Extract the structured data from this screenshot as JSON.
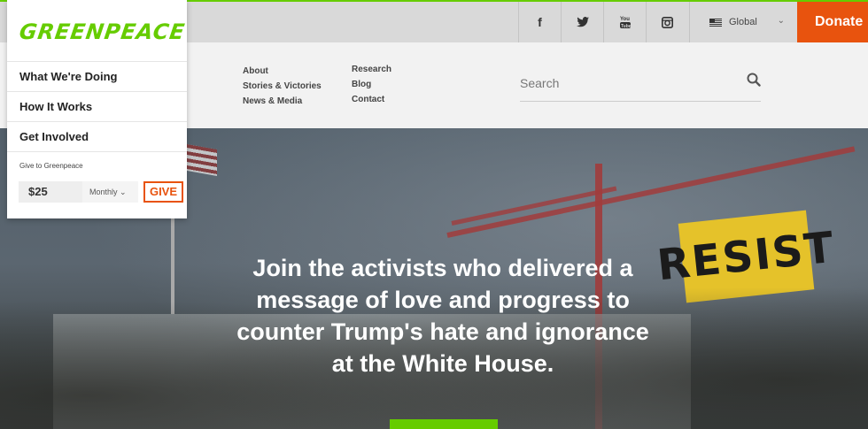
{
  "brand": {
    "logo_text": "GREENPEACE",
    "green": "#66cc00",
    "orange": "#e8530e"
  },
  "topbar": {
    "social": [
      {
        "icon": "facebook-icon",
        "glyph": "f"
      },
      {
        "icon": "twitter-icon",
        "glyph": "🐦"
      },
      {
        "icon": "youtube-icon",
        "glyph": "You"
      },
      {
        "icon": "instagram-icon",
        "glyph": "◙"
      }
    ],
    "region_label": "Global",
    "donate_label": "Donate"
  },
  "nav": {
    "col1": [
      "About",
      "Stories & Victories",
      "News & Media"
    ],
    "col2": [
      "Research",
      "Blog",
      "Contact"
    ]
  },
  "search": {
    "placeholder": "Search"
  },
  "panel": {
    "items": [
      "What We're Doing",
      "How It Works",
      "Get Involved"
    ],
    "give_label": "Give to Greenpeace",
    "amount": "$25",
    "frequency": "Monthly",
    "give_button": "GIVE"
  },
  "hero": {
    "headline": "Join the activists who delivered a message of love and progress to counter Trump's hate and ignorance at the White House.",
    "banner_text": "RESIST"
  }
}
